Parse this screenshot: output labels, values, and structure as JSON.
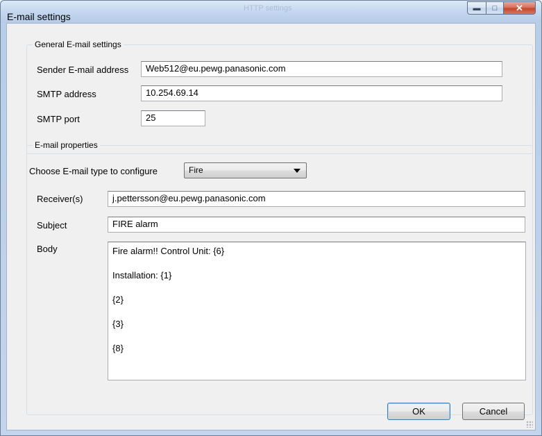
{
  "window": {
    "title": "E-mail settings",
    "ghost_title": "HTTP settings"
  },
  "general": {
    "legend": "General E-mail settings",
    "sender_label": "Sender E-mail address",
    "sender_value": "Web512@eu.pewg.panasonic.com",
    "smtp_label": "SMTP address",
    "smtp_value": "10.254.69.14",
    "port_label": "SMTP port",
    "port_value": "25"
  },
  "properties": {
    "legend": "E-mail properties",
    "type_label": "Choose E-mail type to configure",
    "type_value": "Fire",
    "receivers_label": "Receiver(s)",
    "receivers_value": "j.pettersson@eu.pewg.panasonic.com",
    "subject_label": "Subject",
    "subject_value": "FIRE alarm",
    "body_label": "Body",
    "body_lines": [
      "Fire alarm!!  Control Unit:  {6}",
      "Installation:  {1}",
      "{2}",
      "{3}",
      "{8}"
    ]
  },
  "buttons": {
    "ok": "OK",
    "cancel": "Cancel"
  },
  "icons": {
    "minimize": "minimize-icon",
    "maximize": "maximize-icon",
    "close": "close-icon"
  }
}
